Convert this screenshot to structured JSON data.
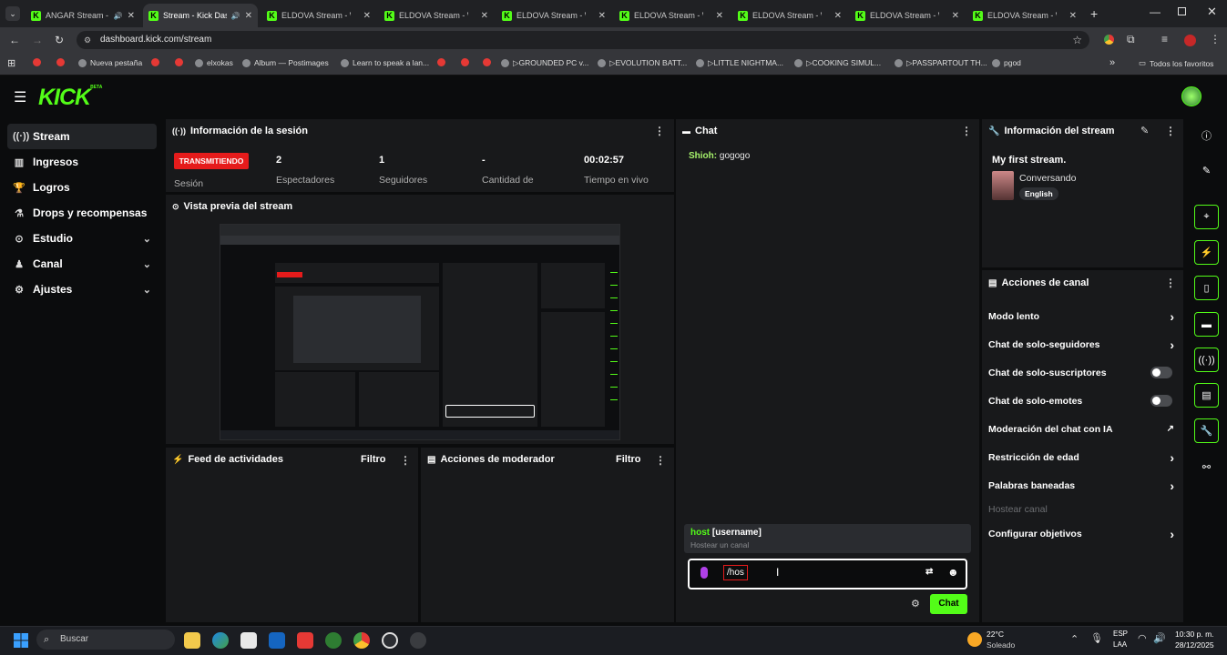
{
  "browser": {
    "tabs": [
      {
        "title": "ANGAR Stream -",
        "active": false
      },
      {
        "title": "Stream - Kick Das",
        "active": true
      },
      {
        "title": "ELDOVA Stream - Wa",
        "active": false
      },
      {
        "title": "ELDOVA Stream - Wa",
        "active": false
      },
      {
        "title": "ELDOVA Stream - Wa",
        "active": false
      },
      {
        "title": "ELDOVA Stream - Wa",
        "active": false
      },
      {
        "title": "ELDOVA Stream - Wa",
        "active": false
      },
      {
        "title": "ELDOVA Stream - Wa",
        "active": false
      },
      {
        "title": "ELDOVA Stream - Wa",
        "active": false
      }
    ],
    "url": "dashboard.kick.com/stream",
    "bookmarks": [
      "Nueva pestaña",
      "elxokas",
      "Album — Postimages",
      "Learn to speak a lan...",
      "▷GROUNDED PC v...",
      "▷EVOLUTION BATT...",
      "▷LITTLE NIGHTMA...",
      "▷COOKING SIMUL...",
      "▷PASSPARTOUT TH...",
      "pgod"
    ],
    "all_bookmarks": "Todos los favoritos"
  },
  "kick": {
    "logo": "KICK",
    "logo_badge": "BETA",
    "sidebar": [
      {
        "label": "Stream",
        "icon": "broadcast-icon"
      },
      {
        "label": "Ingresos",
        "icon": "chart-icon"
      },
      {
        "label": "Logros",
        "icon": "trophy-icon"
      },
      {
        "label": "Drops y recompensas",
        "icon": "gift-icon"
      },
      {
        "label": "Estudio",
        "icon": "studio-icon"
      },
      {
        "label": "Canal",
        "icon": "canal-icon"
      },
      {
        "label": "Ajustes",
        "icon": "gear-icon"
      }
    ],
    "session": {
      "title": "Información de la sesión",
      "status_badge": "TRANSMITIENDO",
      "session_label": "Sesión",
      "viewers_value": "2",
      "viewers_label": "Espectadores",
      "followers_value": "1",
      "followers_label": "Seguidores",
      "amount_value": "-",
      "amount_label": "Cantidad de",
      "live_value": "00:02:57",
      "live_label": "Tiempo en vivo"
    },
    "preview": {
      "title": "Vista previa del stream"
    },
    "activity": {
      "title": "Feed de actividades",
      "filter": "Filtro"
    },
    "moderator": {
      "title": "Acciones de moderador",
      "filter": "Filtro"
    },
    "chat": {
      "title": "Chat",
      "messages": [
        {
          "user": "Shioh:",
          "text": "gogogo"
        }
      ],
      "suggestion_cmd": "host",
      "suggestion_arg": "[username]",
      "suggestion_desc": "Hostear un canal",
      "input_value": "/hos",
      "send_label": "Chat"
    },
    "stream_info": {
      "title": "Información del stream",
      "stream_title": "My first stream.",
      "category": "Conversando",
      "language": "English"
    },
    "channel_actions": {
      "title": "Acciones de canal",
      "items": [
        {
          "label": "Modo lento",
          "control": "arrow"
        },
        {
          "label": "Chat de solo-seguidores",
          "control": "arrow"
        },
        {
          "label": "Chat de solo-suscriptores",
          "control": "toggle"
        },
        {
          "label": "Chat de solo-emotes",
          "control": "toggle"
        },
        {
          "label": "Moderación del chat con IA",
          "control": "link"
        },
        {
          "label": "Restricción de edad",
          "control": "arrow"
        },
        {
          "label": "Palabras baneadas",
          "control": "arrow"
        },
        {
          "label": "Hostear canal",
          "control": "disabled"
        },
        {
          "label": "Configurar objetivos",
          "control": "arrow"
        }
      ]
    }
  },
  "taskbar": {
    "search_placeholder": "Buscar",
    "weather_temp": "22°C",
    "weather_desc": "Soleado",
    "lang": "ESP",
    "lang_sub": "LAA",
    "time": "10:30 p. m.",
    "date": "28/12/2025"
  },
  "colors": {
    "accent": "#53fc18",
    "live_badge": "#e51b1b",
    "panel": "#18191b",
    "background": "#0b0c0d"
  }
}
